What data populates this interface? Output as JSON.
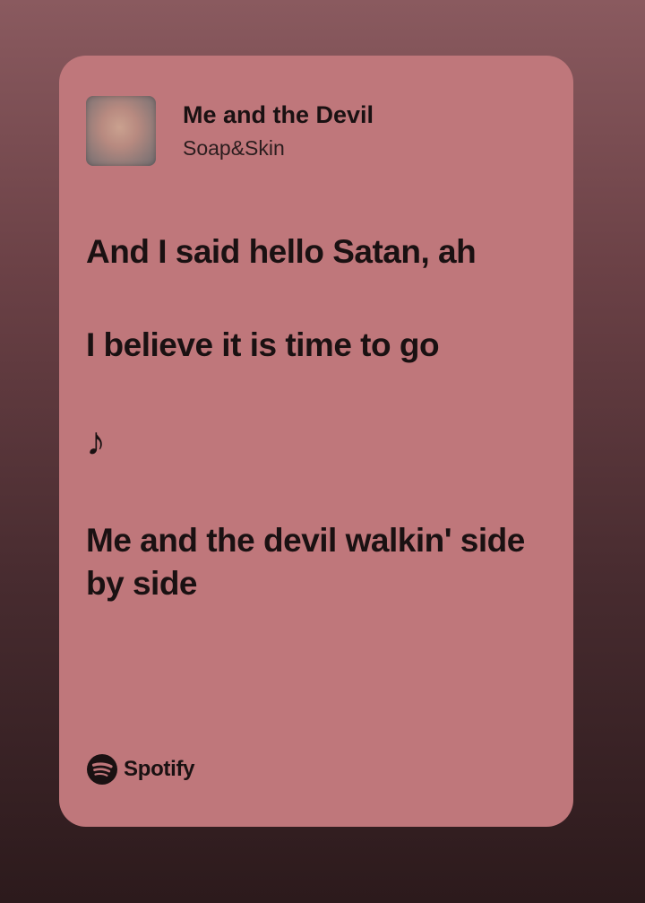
{
  "track": {
    "title": "Me and the Devil",
    "artist": "Soap&Skin"
  },
  "lyrics": [
    "And I said hello Satan, ah",
    "I believe it is time to go",
    "♪",
    "Me and the devil walkin' side by side"
  ],
  "brand": {
    "name": "Spotify",
    "icon": "spotify-icon"
  },
  "colors": {
    "card": "#bf777b",
    "text": "#1a1112"
  }
}
